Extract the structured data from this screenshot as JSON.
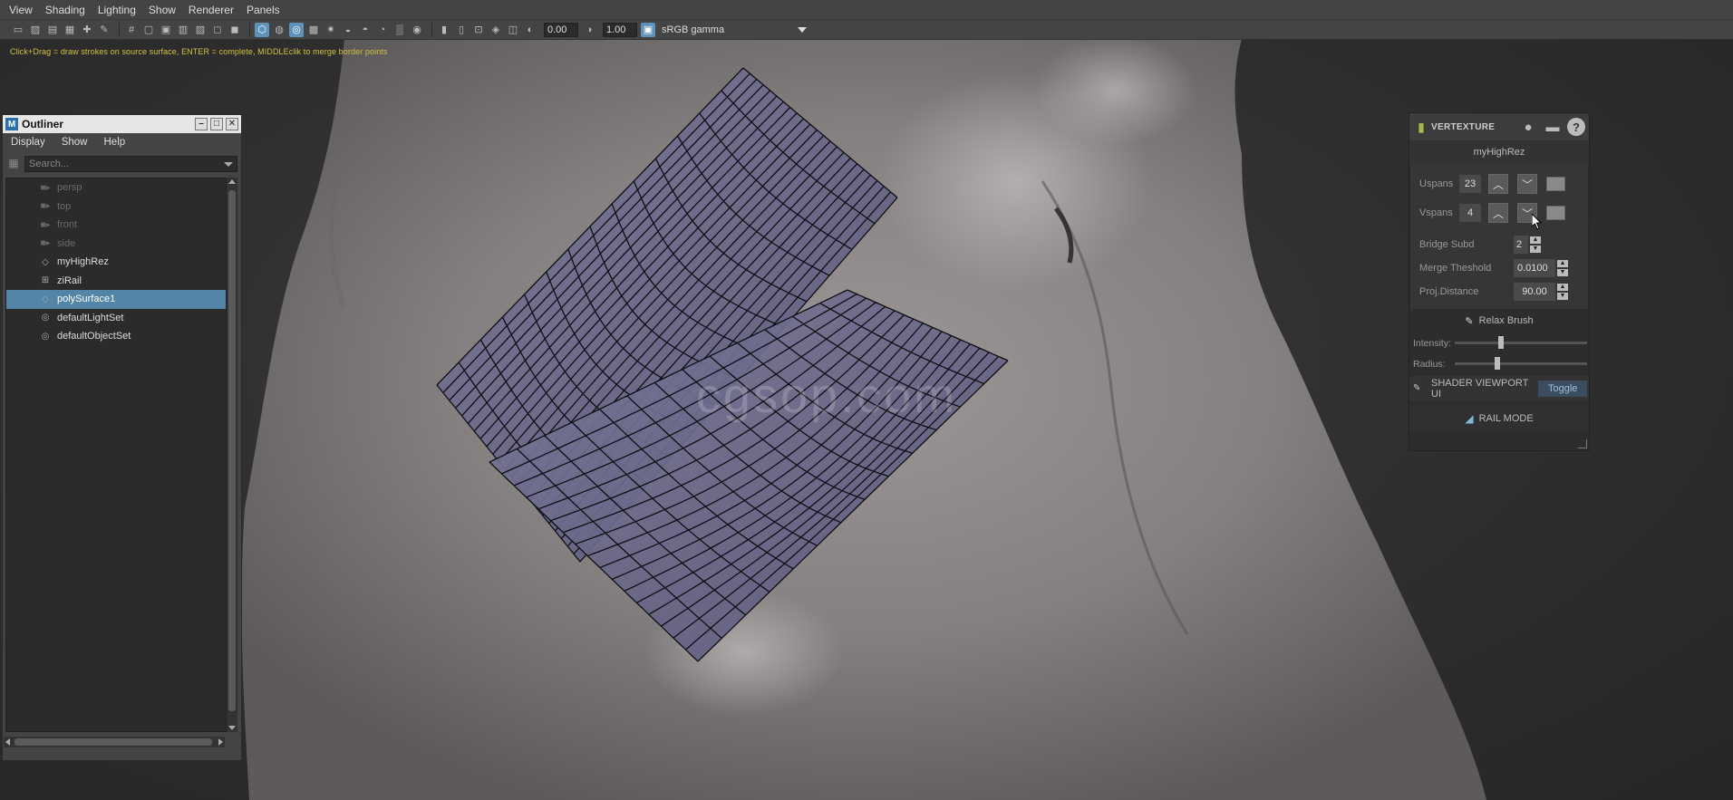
{
  "menubar": {
    "items": [
      "View",
      "Shading",
      "Lighting",
      "Show",
      "Renderer",
      "Panels"
    ]
  },
  "toolbar": {
    "icons": [
      "camera-icon",
      "camera-attributes-icon",
      "bookmark-icon",
      "image-plane-icon",
      "2d-pan-zoom-icon",
      "grease-pencil-icon",
      "grid-icon",
      "film-gate-icon",
      "resolution-gate-icon",
      "gate-mask-icon",
      "field-chart-icon",
      "safe-action-icon",
      "safe-title-icon",
      "wireframe-icon",
      "smooth-shade-icon",
      "wireframe-on-shaded-icon",
      "textured-icon",
      "lights-icon",
      "shadows-icon",
      "screen-space-ao-icon",
      "motion-blur-icon",
      "multisample-aa-icon",
      "depth-of-field-icon",
      "isolate-select-icon",
      "xray-icon",
      "xray-joints-icon",
      "xray-active-icon",
      "backface-culling-icon",
      "exposure-icon",
      "gamma-icon",
      "color-management-icon"
    ],
    "exposure_value": "0.00",
    "gamma_value": "1.00",
    "view_transform": "sRGB gamma"
  },
  "hint_text": "Click+Drag = draw strokes on source surface, ENTER = complete, MIDDLEclik to merge border points",
  "viewport": {
    "watermark": "cgsop.com"
  },
  "outliner": {
    "title": "Outliner",
    "menu": [
      "Display",
      "Show",
      "Help"
    ],
    "search_placeholder": "Search...",
    "items": [
      {
        "label": "persp",
        "icon": "camera-icon",
        "dim": true,
        "selected": false
      },
      {
        "label": "top",
        "icon": "camera-icon",
        "dim": true,
        "selected": false
      },
      {
        "label": "front",
        "icon": "camera-icon",
        "dim": true,
        "selected": false
      },
      {
        "label": "side",
        "icon": "camera-icon",
        "dim": true,
        "selected": false
      },
      {
        "label": "myHighRez",
        "icon": "mesh-icon",
        "dim": false,
        "selected": false
      },
      {
        "label": "ziRail",
        "icon": "ziRail-node-icon",
        "dim": false,
        "selected": false
      },
      {
        "label": "polySurface1",
        "icon": "mesh-icon",
        "dim": false,
        "selected": true
      },
      {
        "label": "defaultLightSet",
        "icon": "set-icon",
        "dim": false,
        "selected": false
      },
      {
        "label": "defaultObjectSet",
        "icon": "set-icon",
        "dim": false,
        "selected": false
      }
    ]
  },
  "vertexture": {
    "brand": "VERTEXTURE",
    "object_name": "myHighRez",
    "uspans_label": "Uspans",
    "uspans_value": "23",
    "vspans_label": "Vspans",
    "vspans_value": "4",
    "bridge_subd_label": "Bridge Subd",
    "bridge_subd_value": "2",
    "merge_threshold_label": "Merge Theshold",
    "merge_threshold_value": "0.0100",
    "proj_distance_label": "Proj.Distance",
    "proj_distance_value": "90.00",
    "relax_brush_label": "Relax Brush",
    "intensity_label": "Intensity:",
    "intensity_level": 0.33,
    "radius_label": "Radius:",
    "radius_level": 0.3,
    "shader_label": "SHADER VIEWPORT UI",
    "toggle_label": "Toggle",
    "rail_mode_label": "RAIL MODE"
  }
}
